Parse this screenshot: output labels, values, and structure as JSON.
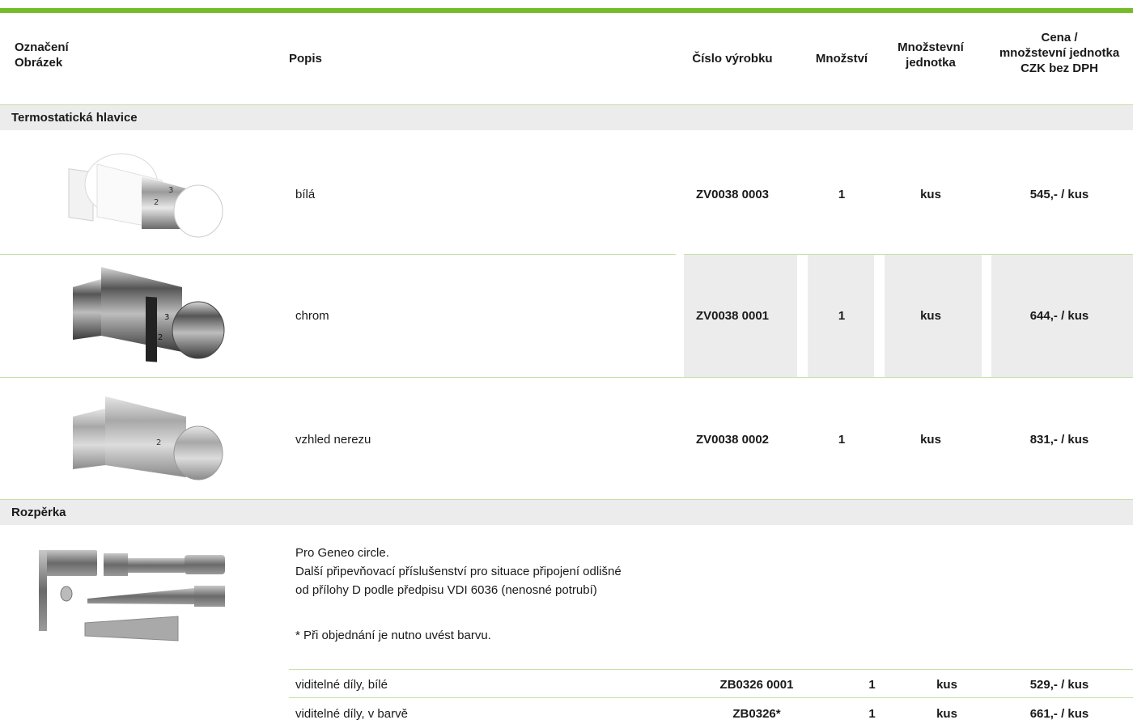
{
  "header": {
    "col1_line1": "Označení",
    "col1_line2": "Obrázek",
    "popis": "Popis",
    "cislo": "Číslo výrobku",
    "mnozstvi": "Množství",
    "jednotka_line1": "Množstevní",
    "jednotka_line2": "jednotka",
    "cena_line1": "Cena /",
    "cena_line2": "množstevní jednotka",
    "cena_line3": "CZK bez DPH"
  },
  "sections": [
    {
      "title": "Termostatická hlavice",
      "rows": [
        {
          "desc": "bílá",
          "code": "ZV0038 0003",
          "qty": "1",
          "unit": "kus",
          "price": "545,- / kus"
        },
        {
          "desc": "chrom",
          "code": "ZV0038 0001",
          "qty": "1",
          "unit": "kus",
          "price": "644,- / kus"
        },
        {
          "desc": "vzhled nerezu",
          "code": "ZV0038 0002",
          "qty": "1",
          "unit": "kus",
          "price": "831,- / kus"
        }
      ]
    },
    {
      "title": "Rozpěrka",
      "description_lines": [
        "Pro Geneo circle.",
        "Další připevňovací příslušenství pro situace připojení odlišné",
        "od přílohy D podle předpisu VDI 6036 (nenosné potrubí)"
      ],
      "note": "* Při objednání je nutno uvést barvu.",
      "rows": [
        {
          "desc": "viditelné díly, bílé",
          "code": "ZB0326 0001",
          "qty": "1",
          "unit": "kus",
          "price": "529,- / kus"
        },
        {
          "desc": "viditelné díly, v barvě",
          "code": "ZB0326*",
          "qty": "1",
          "unit": "kus",
          "price": "661,- / kus"
        }
      ]
    }
  ]
}
